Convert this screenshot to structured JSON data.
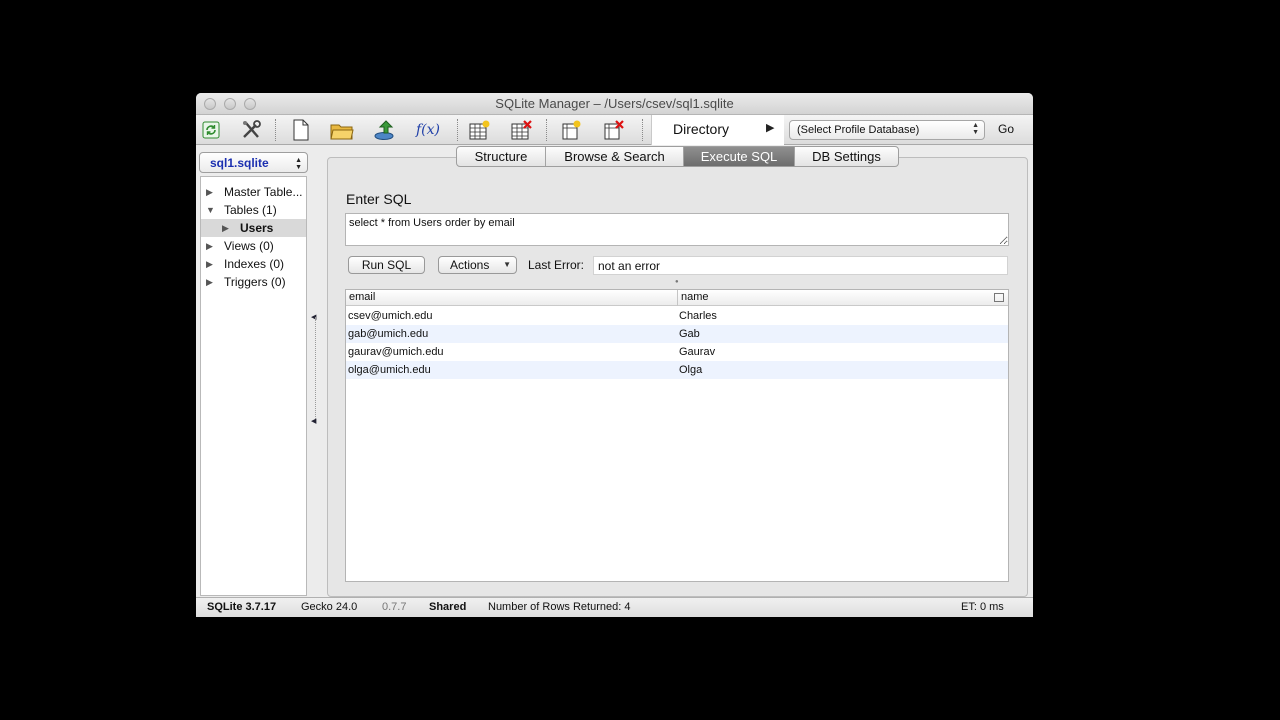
{
  "window": {
    "title": "SQLite Manager – /Users/csev/sql1.sqlite"
  },
  "toolbar": {
    "icons": [
      "refresh-icon",
      "tools-icon",
      "new-database-icon",
      "open-database-icon",
      "connect-database-icon",
      "function-icon",
      "create-table-icon",
      "drop-table-icon",
      "create-index-icon",
      "drop-index-icon"
    ],
    "function_label": "f(x)",
    "directory_label": "Directory",
    "profile_select": "(Select Profile Database)",
    "go_label": "Go"
  },
  "sidebar": {
    "db_select": "sql1.sqlite",
    "items": [
      {
        "label": "Master Table...",
        "level": 0
      },
      {
        "label": "Tables (1)",
        "level": 0,
        "expanded": true
      },
      {
        "label": "Users",
        "level": 1,
        "selected": true
      },
      {
        "label": "Views (0)",
        "level": 0
      },
      {
        "label": "Indexes (0)",
        "level": 0
      },
      {
        "label": "Triggers (0)",
        "level": 0
      }
    ]
  },
  "tabs": [
    {
      "label": "Structure",
      "active": false
    },
    {
      "label": "Browse & Search",
      "active": false
    },
    {
      "label": "Execute SQL",
      "active": true
    },
    {
      "label": "DB Settings",
      "active": false
    }
  ],
  "sql": {
    "heading": "Enter SQL",
    "query": "select * from Users order by email",
    "run_label": "Run SQL",
    "actions_label": "Actions",
    "last_error_label": "Last Error:",
    "last_error_value": "not an error"
  },
  "results": {
    "columns": [
      "email",
      "name"
    ],
    "rows": [
      [
        "csev@umich.edu",
        "Charles"
      ],
      [
        "gab@umich.edu",
        "Gab"
      ],
      [
        "gaurav@umich.edu",
        "Gaurav"
      ],
      [
        "olga@umich.edu",
        "Olga"
      ]
    ]
  },
  "status": {
    "sqlite_version": "SQLite 3.7.17",
    "gecko": "Gecko 24.0",
    "ext_version": "0.7.7",
    "mode": "Shared",
    "rows_returned": "Number of Rows Returned: 4",
    "elapsed": "ET: 0 ms"
  }
}
